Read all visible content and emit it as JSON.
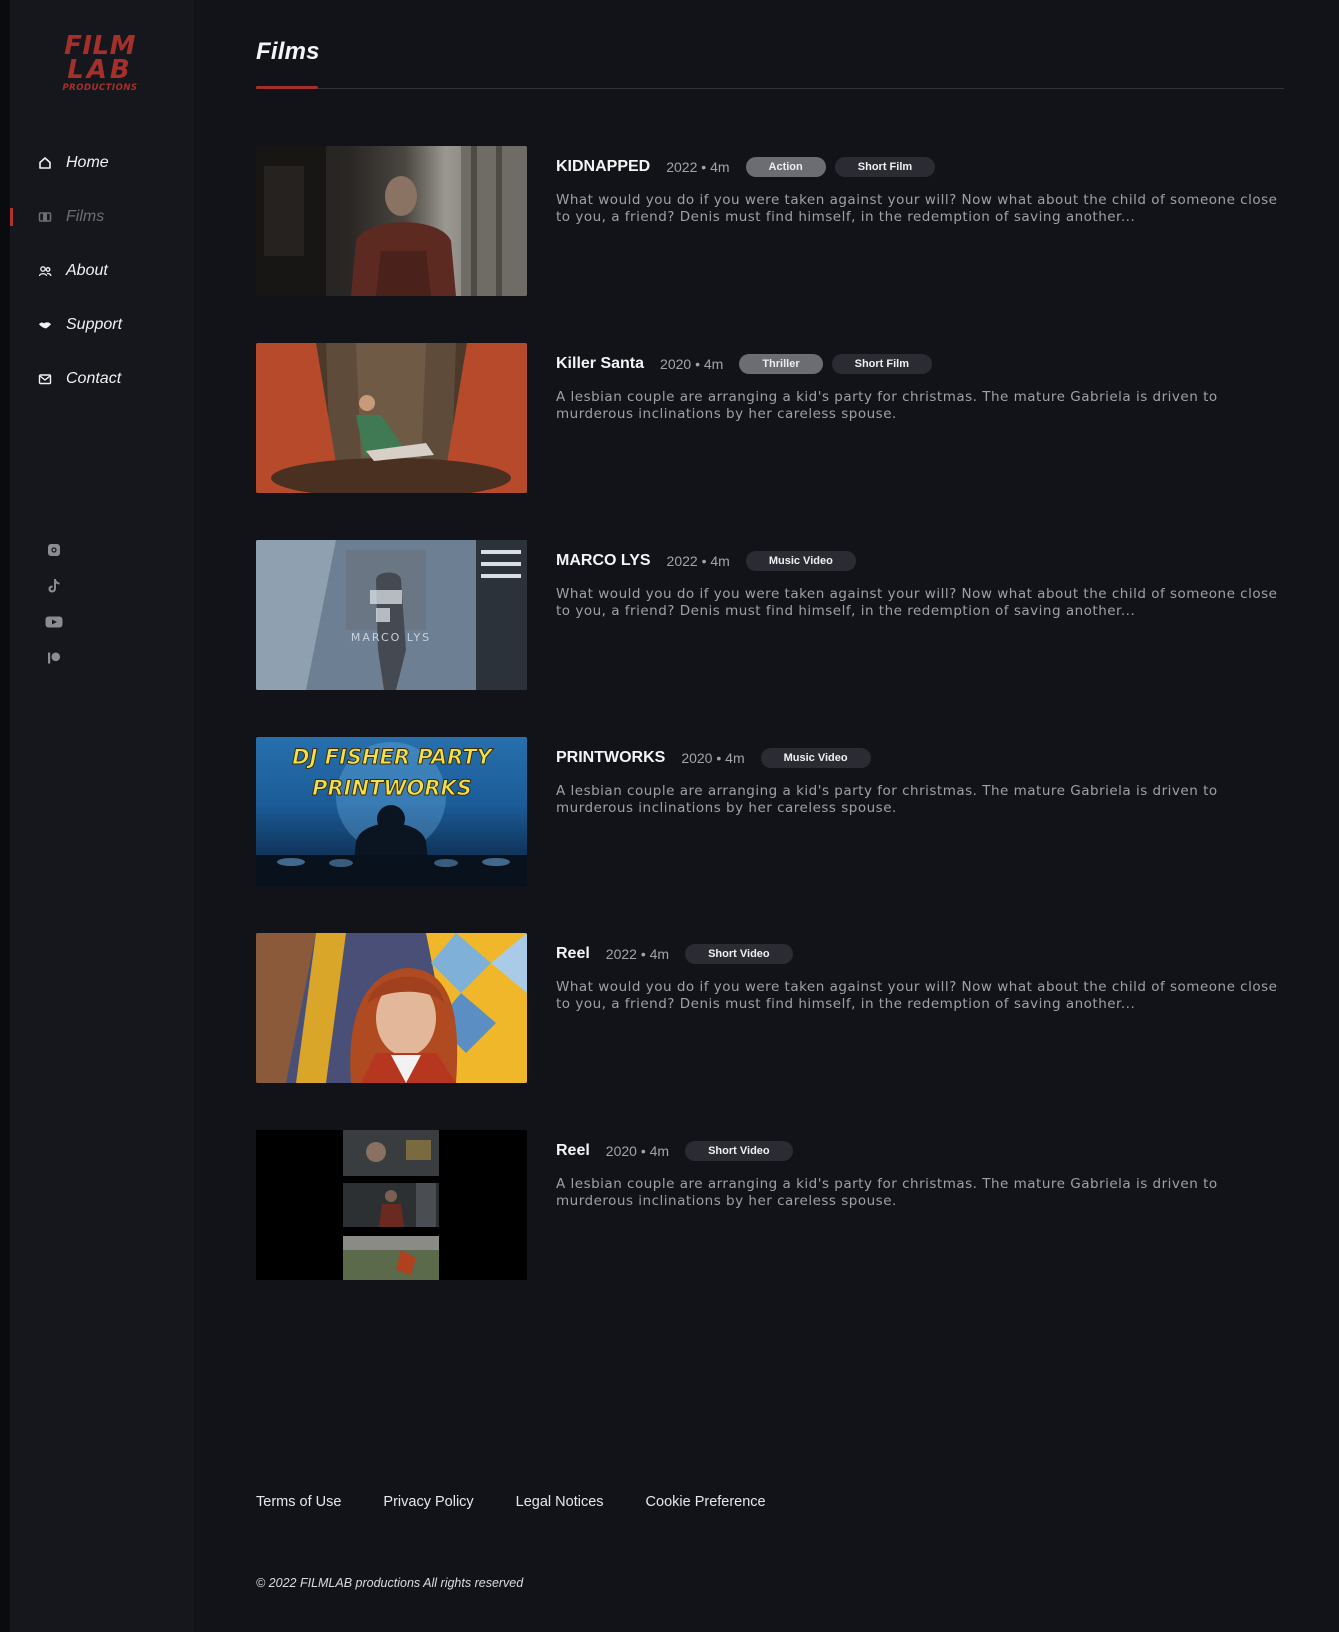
{
  "logo": {
    "line1": "FILM",
    "line2": "LAB",
    "line3": "PRODUCTIONS"
  },
  "nav": [
    {
      "label": "Home",
      "icon": "home-icon"
    },
    {
      "label": "Films",
      "icon": "film-icon",
      "active": true
    },
    {
      "label": "About",
      "icon": "users-icon"
    },
    {
      "label": "Support",
      "icon": "handshake-icon"
    },
    {
      "label": "Contact",
      "icon": "mail-icon"
    }
  ],
  "socials": [
    "instagram-icon",
    "tiktok-icon",
    "youtube-icon",
    "patreon-icon"
  ],
  "page_title": "Films",
  "films": [
    {
      "title": "KIDNAPPED",
      "year": "2022",
      "duration": "4m",
      "tags": [
        "Action",
        "Short Film"
      ],
      "description": "What would you do if you were taken against your will? Now what about the child of someone close to you, a friend? Denis must find himself, in the redemption of saving another..."
    },
    {
      "title": "Killer Santa",
      "year": "2020",
      "duration": "4m",
      "tags": [
        "Thriller",
        "Short Film"
      ],
      "description": "A lesbian couple are arranging a kid's party for christmas. The mature Gabriela is driven to murderous inclinations by her careless spouse."
    },
    {
      "title": "MARCO LYS",
      "year": "2022",
      "duration": "4m",
      "tags": [
        "Music Video"
      ],
      "thumb_text": "MARCO LYS",
      "description": "What would you do if you were taken against your will? Now what about the child of someone close to you, a friend? Denis must find himself, in the redemption of saving another..."
    },
    {
      "title": "PRINTWORKS",
      "year": "2020",
      "duration": "4m",
      "tags": [
        "Music Video"
      ],
      "thumb_line1": "DJ FISHER PARTY",
      "thumb_line2": "PRINTWORKS",
      "description": "A lesbian couple are arranging a kid's party for christmas. The mature Gabriela is driven to murderous inclinations by her careless spouse."
    },
    {
      "title": "Reel",
      "year": "2022",
      "duration": "4m",
      "tags": [
        "Short Video"
      ],
      "description": "What would you do if you were taken against your will? Now what about the child of someone close to you, a friend? Denis must find himself, in the redemption of saving another..."
    },
    {
      "title": "Reel",
      "year": "2020",
      "duration": "4m",
      "tags": [
        "Short Video"
      ],
      "description": "A lesbian couple are arranging a kid's party for christmas. The mature Gabriela is driven to murderous inclinations by her careless spouse."
    }
  ],
  "footer": {
    "links": [
      "Terms of Use",
      "Privacy Policy",
      "Legal Notices",
      "Cookie Preference"
    ],
    "copyright": "© 2022 FILMLAB productions All rights reserved"
  },
  "colors": {
    "accent": "#a5302b",
    "background": "#121318",
    "sidebar": "#16171d"
  }
}
